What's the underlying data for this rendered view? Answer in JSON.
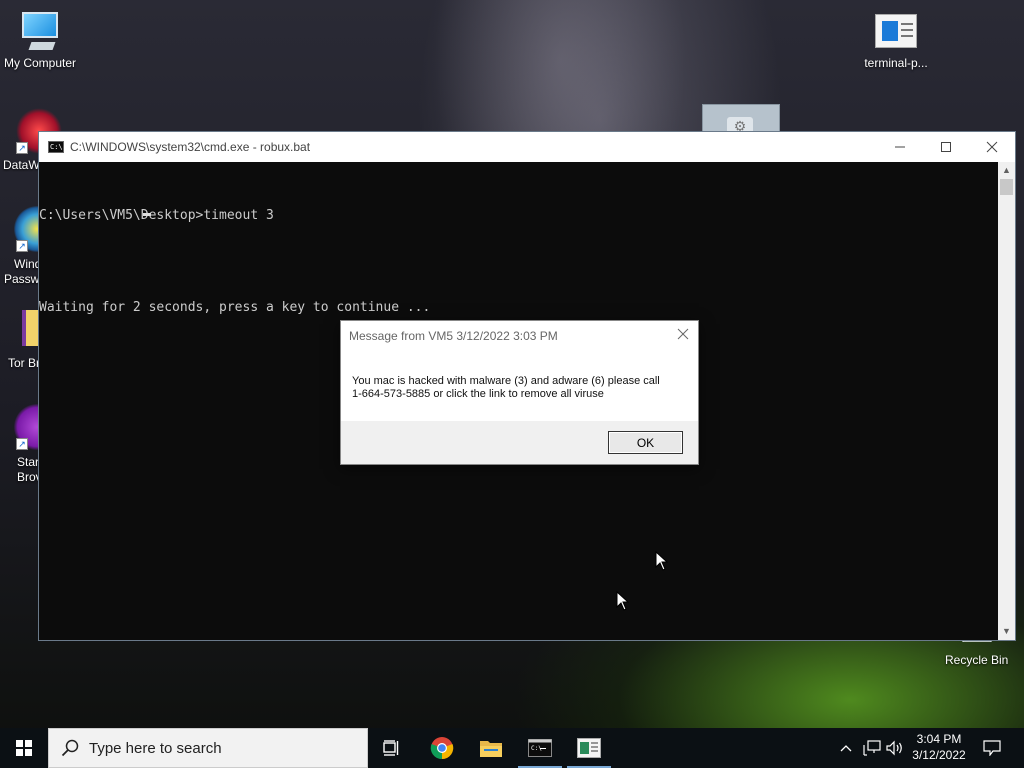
{
  "desktop": {
    "icons": {
      "my_computer": "My Computer",
      "terminal": "terminal-p...",
      "recycle_bin": "Recycle Bin",
      "dataw": "DataW",
      "wind": "Wind",
      "passwo": "Passwo",
      "tor": "Tor Br",
      "start_top": "Start",
      "start_bottom": "Brov"
    }
  },
  "cmd_window": {
    "title": "C:\\WINDOWS\\system32\\cmd.exe - robux.bat",
    "lines": [
      "C:\\Users\\VM5\\Desktop>timeout 3",
      "Waiting for 2 seconds, press a key to continue ..."
    ]
  },
  "message_dialog": {
    "title": "Message from VM5 3/12/2022 3:03 PM",
    "body_line1": "You mac is hacked with malware (3) and adware (6) please call",
    "body_line2": "1-664-573-5885 or click the link to remove all viruse",
    "ok_label": "OK"
  },
  "taskbar": {
    "search_placeholder": "Type here to search",
    "pinned": [
      "task-view",
      "chrome",
      "file-explorer",
      "command-prompt",
      "terminal-app"
    ],
    "clock": {
      "time": "3:04 PM",
      "date": "3/12/2022"
    },
    "accent_color": "#7aa9d6"
  },
  "colors": {
    "console_bg": "#0c0c0c",
    "console_text": "#cccccc",
    "taskbar_bg": "#0b1014"
  }
}
